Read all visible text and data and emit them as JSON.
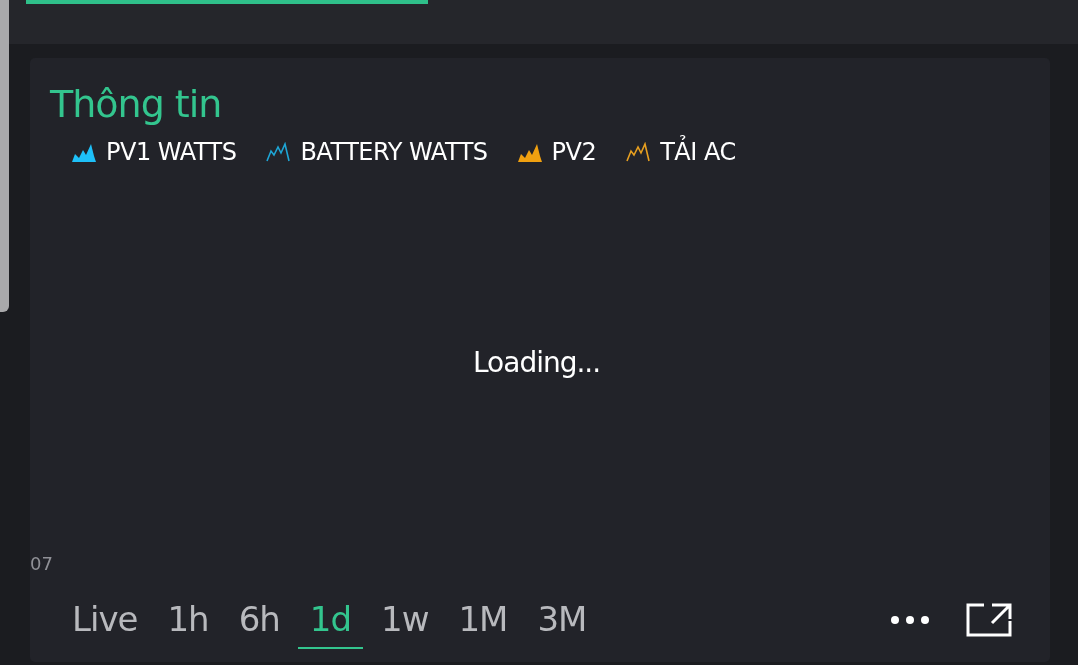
{
  "card": {
    "title": "Thông tin",
    "legend": [
      {
        "label": "PV1 WATTS",
        "kind": "area",
        "color": "#1ec0f8"
      },
      {
        "label": "BATTERY WATTS",
        "kind": "line",
        "color": "#1ea6d6"
      },
      {
        "label": "PV2",
        "kind": "area",
        "color": "#f0a010"
      },
      {
        "label": "TẢI AC",
        "kind": "line",
        "color": "#e8a020"
      }
    ],
    "status": "Loading...",
    "axis_label": "07",
    "ranges": [
      {
        "label": "Live",
        "selected": false
      },
      {
        "label": "1h",
        "selected": false
      },
      {
        "label": "6h",
        "selected": false
      },
      {
        "label": "1d",
        "selected": true
      },
      {
        "label": "1w",
        "selected": false
      },
      {
        "label": "1M",
        "selected": false
      },
      {
        "label": "3M",
        "selected": false
      }
    ]
  }
}
